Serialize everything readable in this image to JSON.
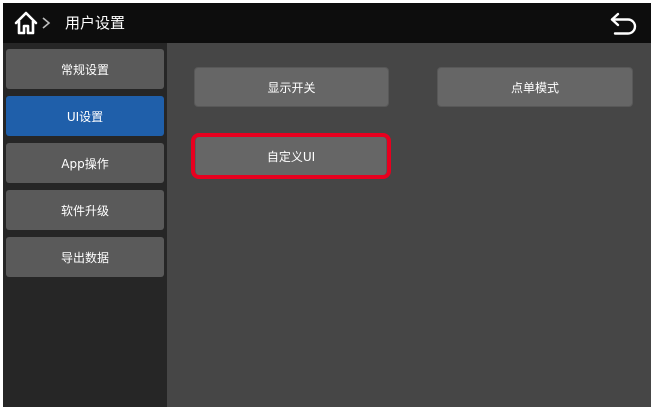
{
  "header": {
    "title": "用户设置",
    "home_icon": "home-icon",
    "separator_icon": "chevron-right-icon",
    "back_icon": "back-arrow-icon"
  },
  "sidebar": {
    "items": [
      {
        "label": "常规设置",
        "active": false
      },
      {
        "label": "UI设置",
        "active": true
      },
      {
        "label": "App操作",
        "active": false
      },
      {
        "label": "软件升级",
        "active": false
      },
      {
        "label": "导出数据",
        "active": false
      }
    ]
  },
  "main": {
    "buttons": [
      {
        "label": "显示开关"
      },
      {
        "label": "点单模式"
      },
      {
        "label": "自定义UI"
      }
    ]
  },
  "colors": {
    "active": "#1f5faa",
    "highlight": "#e8001f",
    "button": "#666666",
    "content_bg": "#464646"
  }
}
